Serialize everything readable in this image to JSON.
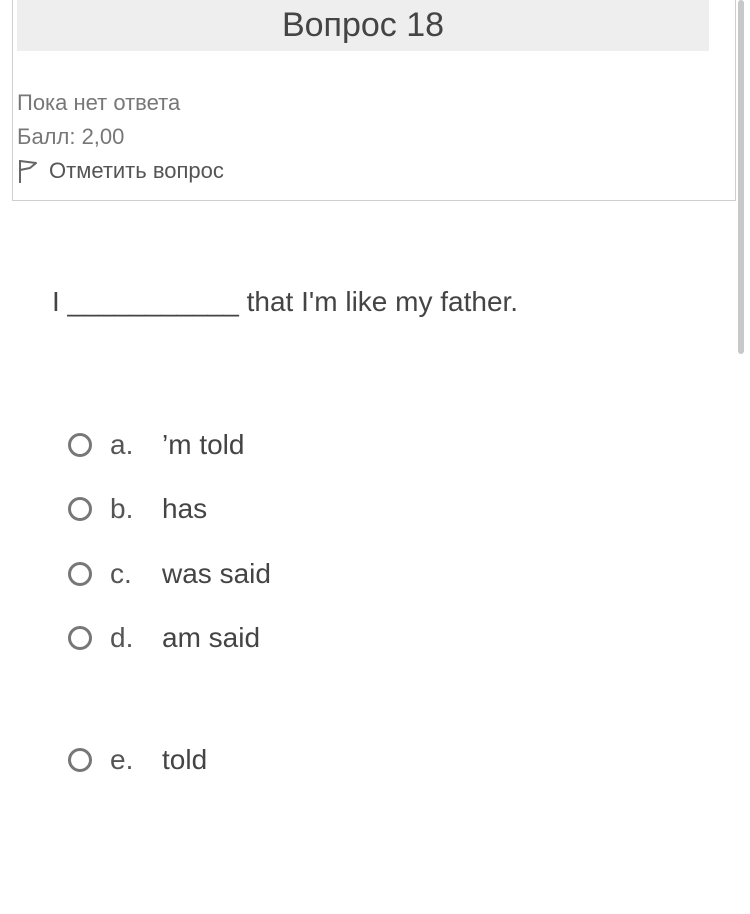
{
  "header": {
    "title": "Вопрос 18"
  },
  "info": {
    "status": "Пока нет ответа",
    "grade": "Балл: 2,00",
    "flag_label": "Отметить вопрос"
  },
  "question": {
    "text": "I ___________ that I'm like my father."
  },
  "options": [
    {
      "letter": "a.",
      "text": "’m told"
    },
    {
      "letter": "b.",
      "text": "has"
    },
    {
      "letter": "c.",
      "text": "was said"
    },
    {
      "letter": "d.",
      "text": "am said"
    },
    {
      "letter": "e.",
      "text": "told"
    }
  ],
  "icons": {
    "flag": "flag-icon",
    "radio": "radio-unchecked-icon"
  },
  "colors": {
    "title_bar_bg": "#eeeeee",
    "border": "#cfcfcf",
    "muted_text": "#777777"
  }
}
